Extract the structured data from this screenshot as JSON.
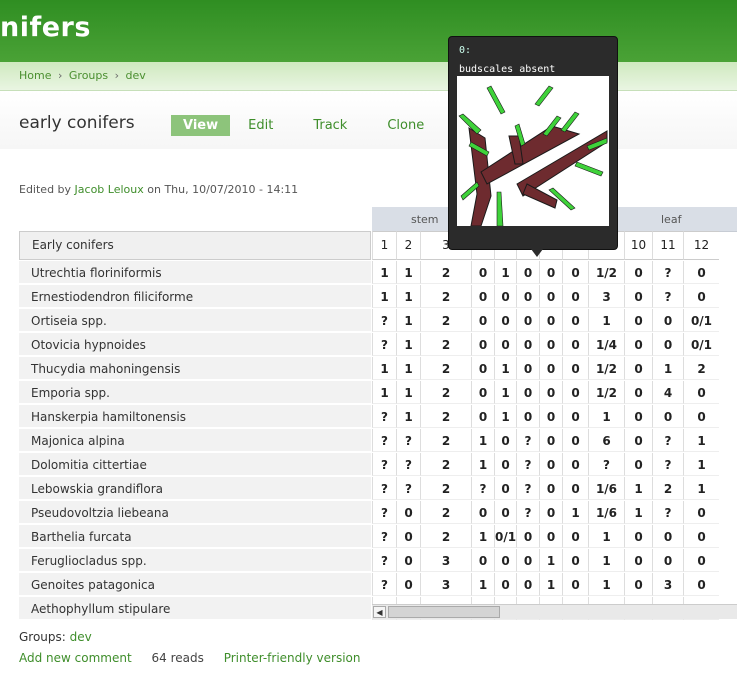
{
  "site": {
    "title": "nifers"
  },
  "breadcrumb": {
    "home": "Home",
    "groups": "Groups",
    "dev": "dev",
    "sep": "›"
  },
  "page": {
    "title": "early conifers",
    "tabs": [
      "View",
      "Edit",
      "Track",
      "Clone"
    ]
  },
  "meta": {
    "prefix": "Edited by",
    "author": "Jacob Leloux",
    "date": "on Thu, 10/07/2010 - 14:11"
  },
  "matrix": {
    "groups": [
      "stem",
      "leaf"
    ],
    "header_label": "Early conifers",
    "columns": [
      "1",
      "2",
      "3",
      "4",
      "5",
      "6",
      "7",
      "8",
      "9",
      "10",
      "11",
      "12"
    ],
    "rows": [
      {
        "name": "Utrechtia floriniformis",
        "values": [
          "1",
          "1",
          "2",
          "0",
          "1",
          "0",
          "0",
          "0",
          "1/2",
          "0",
          "?",
          "0"
        ]
      },
      {
        "name": "Ernestiodendron filiciforme",
        "values": [
          "1",
          "1",
          "2",
          "0",
          "0",
          "0",
          "0",
          "0",
          "3",
          "0",
          "?",
          "0"
        ]
      },
      {
        "name": "Ortiseia spp.",
        "values": [
          "?",
          "1",
          "2",
          "0",
          "0",
          "0",
          "0",
          "0",
          "1",
          "0",
          "0",
          "0/1"
        ]
      },
      {
        "name": "Otovicia hypnoides",
        "values": [
          "?",
          "1",
          "2",
          "0",
          "0",
          "0",
          "0",
          "0",
          "1/4",
          "0",
          "0",
          "0/1"
        ]
      },
      {
        "name": "Thucydia mahoningensis",
        "values": [
          "1",
          "1",
          "2",
          "0",
          "1",
          "0",
          "0",
          "0",
          "1/2",
          "0",
          "1",
          "2"
        ]
      },
      {
        "name": "Emporia spp.",
        "values": [
          "1",
          "1",
          "2",
          "0",
          "1",
          "0",
          "0",
          "0",
          "1/2",
          "0",
          "4",
          "0"
        ]
      },
      {
        "name": "Hanskerpia hamiltonensis",
        "values": [
          "?",
          "1",
          "2",
          "0",
          "1",
          "0",
          "0",
          "0",
          "1",
          "0",
          "0",
          "0"
        ]
      },
      {
        "name": "Majonica alpina",
        "values": [
          "?",
          "?",
          "2",
          "1",
          "0",
          "?",
          "0",
          "0",
          "6",
          "0",
          "?",
          "1"
        ]
      },
      {
        "name": "Dolomitia cittertiae",
        "values": [
          "?",
          "?",
          "2",
          "1",
          "0",
          "?",
          "0",
          "0",
          "?",
          "0",
          "?",
          "1"
        ]
      },
      {
        "name": "Lebowskia grandiflora",
        "values": [
          "?",
          "?",
          "2",
          "?",
          "0",
          "?",
          "0",
          "0",
          "1/6",
          "1",
          "2",
          "1"
        ]
      },
      {
        "name": "Pseudovoltzia liebeana",
        "values": [
          "?",
          "0",
          "2",
          "0",
          "0",
          "?",
          "0",
          "1",
          "1/6",
          "1",
          "?",
          "0"
        ]
      },
      {
        "name": "Barthelia furcata",
        "values": [
          "?",
          "0",
          "2",
          "1",
          "0/1",
          "0",
          "0",
          "0",
          "1",
          "0",
          "0",
          "0"
        ]
      },
      {
        "name": "Ferugliocladus spp.",
        "values": [
          "?",
          "0",
          "3",
          "0",
          "0",
          "0",
          "1",
          "0",
          "1",
          "0",
          "0",
          "0"
        ]
      },
      {
        "name": "Genoites patagonica",
        "values": [
          "?",
          "0",
          "3",
          "1",
          "0",
          "0",
          "1",
          "0",
          "1",
          "0",
          "3",
          "0"
        ]
      },
      {
        "name": "Aethophyllum stipulare",
        "values": [
          "",
          "",
          "",
          "",
          "",
          "",
          "",
          "",
          "",
          "",
          "",
          ""
        ]
      }
    ]
  },
  "tooltip": {
    "code": "0:",
    "text": "budscales absent"
  },
  "footer": {
    "groups_label": "Groups:",
    "groups_link": "dev",
    "add_comment": "Add new comment",
    "reads": "64 reads",
    "printer": "Printer-friendly version"
  },
  "colors": {
    "header_green": "#3c9a2b",
    "link_green": "#3f8e2b",
    "active_tab": "#8dc47b"
  }
}
